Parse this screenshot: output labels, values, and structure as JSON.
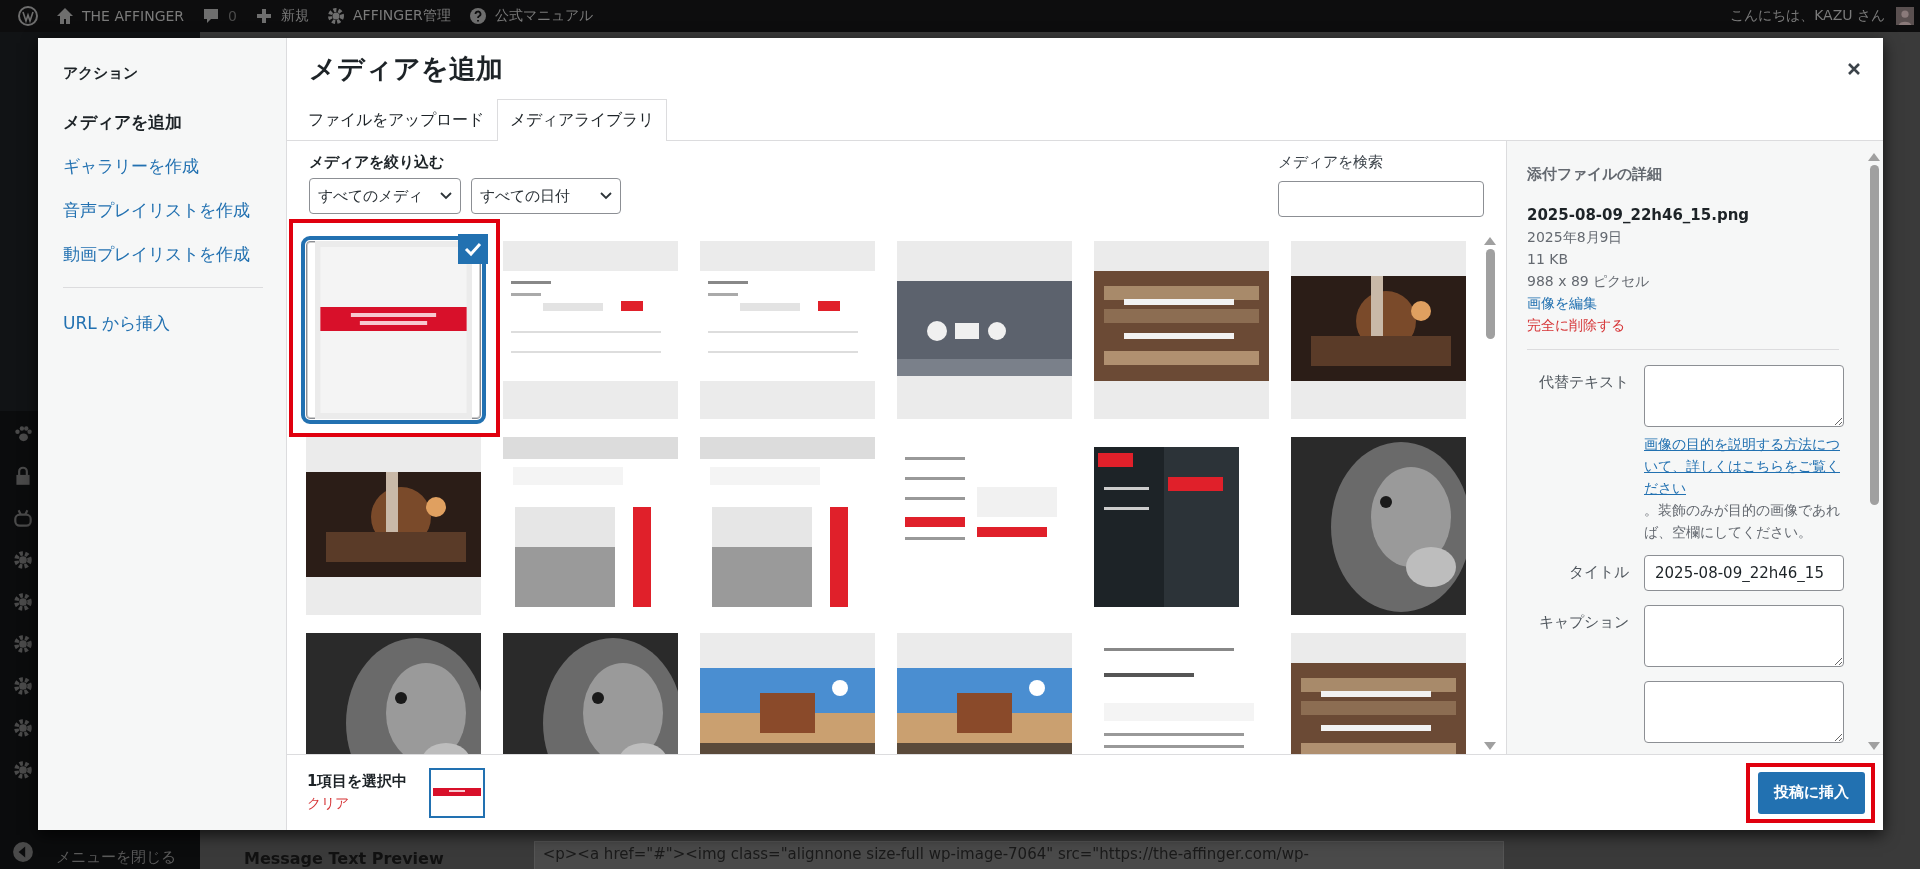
{
  "admin_bar": {
    "site": "THE AFFINGER",
    "comments": "0",
    "new": "新規",
    "theme_admin": "AFFINGER管理",
    "manual": "公式マニュアル",
    "greeting": "こんにちは、KAZU さん"
  },
  "admin_menu": {
    "collapse": "メニューを閉じる"
  },
  "background": {
    "label": "Message Text Preview",
    "code": "<p><a href=\"#\"><img class=\"alignnone size-full wp-image-7064\" src=\"https://the-affinger.com/wp-"
  },
  "modal": {
    "title": "メディアを追加",
    "sidebar": {
      "heading": "アクション",
      "items": [
        {
          "label": "メディアを追加",
          "selected": true
        },
        {
          "label": "ギャラリーを作成",
          "selected": false
        },
        {
          "label": "音声プレイリストを作成",
          "selected": false
        },
        {
          "label": "動画プレイリストを作成",
          "selected": false
        }
      ],
      "url_item": "URL から挿入"
    },
    "tabs": [
      {
        "label": "ファイルをアップロード",
        "selected": false
      },
      {
        "label": "メディアライブラリ",
        "selected": true
      }
    ],
    "filter": {
      "label": "メディアを絞り込む",
      "type_select": "すべてのメディ",
      "date_select": "すべての日付"
    },
    "search": {
      "label": "メディアを検索"
    },
    "attachments": [
      {
        "kind": "banner",
        "selected": true,
        "highlighted": true
      },
      {
        "kind": "form",
        "selected": false,
        "highlighted": false
      },
      {
        "kind": "form",
        "selected": false,
        "highlighted": false
      },
      {
        "kind": "icons",
        "selected": false,
        "highlighted": false
      },
      {
        "kind": "keyboard",
        "selected": false,
        "highlighted": false
      },
      {
        "kind": "sewing",
        "selected": false,
        "highlighted": false
      },
      {
        "kind": "sewing",
        "selected": false,
        "highlighted": false
      },
      {
        "kind": "colorui",
        "selected": false,
        "highlighted": false
      },
      {
        "kind": "colorui",
        "selected": false,
        "highlighted": false
      },
      {
        "kind": "menu",
        "selected": false,
        "highlighted": false
      },
      {
        "kind": "darkmenu",
        "selected": false,
        "highlighted": false
      },
      {
        "kind": "lion",
        "selected": false,
        "highlighted": false
      },
      {
        "kind": "lion",
        "selected": false,
        "highlighted": false
      },
      {
        "kind": "lion",
        "selected": false,
        "highlighted": false
      },
      {
        "kind": "beach",
        "selected": false,
        "highlighted": false
      },
      {
        "kind": "beach",
        "selected": false,
        "highlighted": false
      },
      {
        "kind": "panel",
        "selected": false,
        "highlighted": false
      },
      {
        "kind": "keyboard",
        "selected": false,
        "highlighted": false
      }
    ],
    "details": {
      "heading": "添付ファイルの詳細",
      "filename": "2025-08-09_22h46_15.png",
      "date": "2025年8月9日",
      "size": "11 KB",
      "dimensions": "988 x 89 ピクセル",
      "edit_link": "画像を編集",
      "delete_link": "完全に削除する",
      "alt_label": "代替テキスト",
      "help_link": "画像の目的を説明する方法について、詳しくはこちらをご覧ください",
      "help_text": "。装飾のみが目的の画像であれば、空欄にしてください。",
      "title_label": "タイトル",
      "title_value": "2025-08-09_22h46_15",
      "caption_label": "キャプション"
    },
    "toolbar": {
      "count": "1項目を選択中",
      "clear": "クリア",
      "insert_button": "投稿に挿入",
      "insert_highlighted": true
    }
  }
}
